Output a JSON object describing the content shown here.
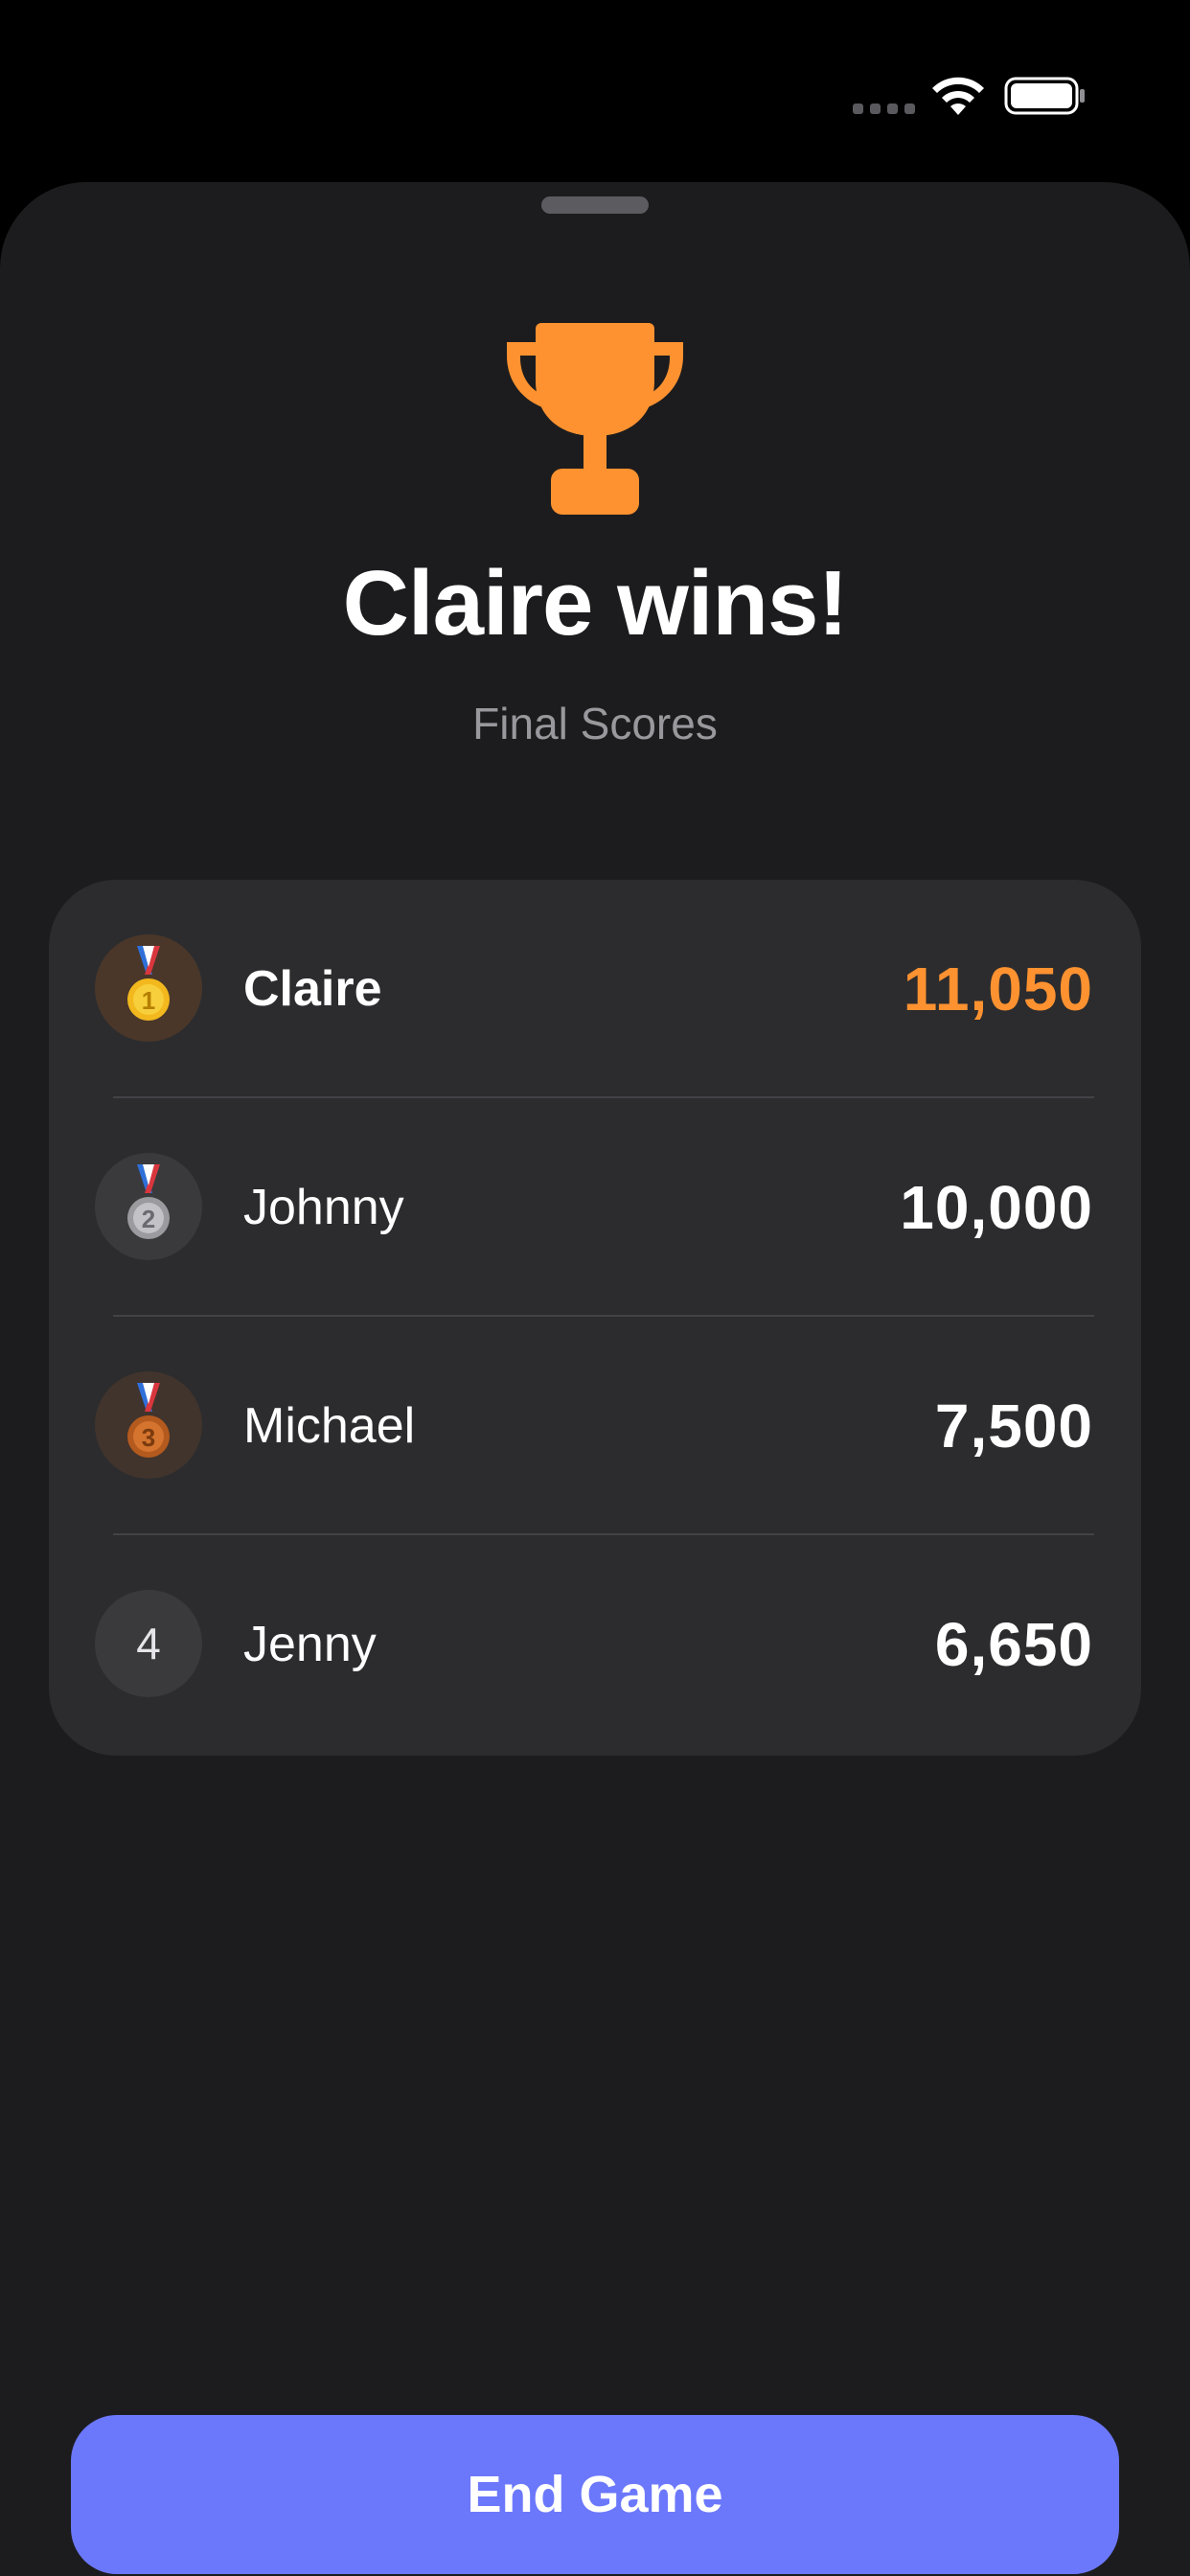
{
  "header": {
    "title": "Claire wins!",
    "subtitle": "Final Scores"
  },
  "colors": {
    "accent": "#ff9230",
    "button": "#6b78fb",
    "sheet": "#1c1c1e",
    "card": "#2c2c2e"
  },
  "icons": {
    "hero": "trophy-icon",
    "status": [
      "cellular-signal-icon",
      "wifi-icon",
      "battery-icon"
    ]
  },
  "scores": [
    {
      "rank": "1",
      "badge": "gold-medal-icon",
      "name": "Claire",
      "score": "11,050",
      "highlight": true
    },
    {
      "rank": "2",
      "badge": "silver-medal-icon",
      "name": "Johnny",
      "score": "10,000",
      "highlight": false
    },
    {
      "rank": "3",
      "badge": "bronze-medal-icon",
      "name": "Michael",
      "score": "7,500",
      "highlight": false
    },
    {
      "rank": "4",
      "badge": "rank-number",
      "name": "Jenny",
      "score": "6,650",
      "highlight": false
    }
  ],
  "actions": {
    "end_game_label": "End Game"
  }
}
